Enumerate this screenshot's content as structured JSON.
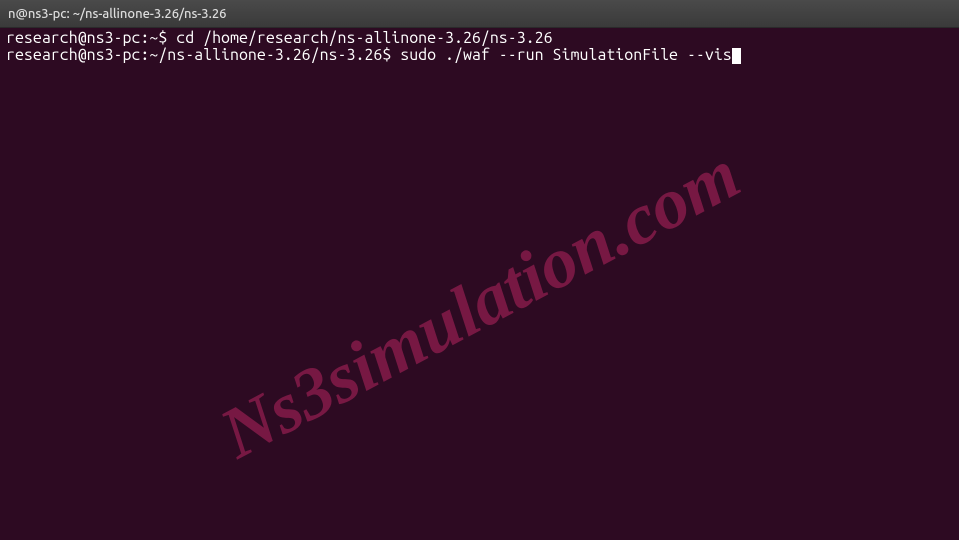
{
  "titlebar": {
    "text": "n@ns3-pc: ~/ns-allinone-3.26/ns-3.26"
  },
  "lines": [
    {
      "prompt": "research@ns3-pc:~$",
      "command": " cd /home/research/ns-allinone-3.26/ns-3.26"
    },
    {
      "prompt": "research@ns3-pc:~/ns-allinone-3.26/ns-3.26$",
      "command": " sudo ./waf --run SimulationFile --vis"
    }
  ],
  "colors": {
    "terminal_bg": "#2d0a22",
    "titlebar_bg": "#3a3a3a",
    "text": "#ffffff",
    "watermark": "rgba(148,30,80,0.72)"
  },
  "watermark": {
    "text": "Ns3simulation.com"
  }
}
